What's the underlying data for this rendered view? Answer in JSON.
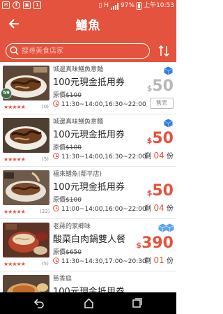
{
  "status_bar": {
    "battery": "97%",
    "time": "上午10:53",
    "network": "H"
  },
  "header": {
    "title": "鱔魚",
    "search_placeholder": "搜尋美食店家"
  },
  "items": [
    {
      "store": "城邊真味鱔魚意麵",
      "offer": "100元現金抵用券",
      "original_label": "原價",
      "original_price": "$100",
      "hours": "11:30~14:00,16:30~22:00",
      "rating_count": "(0)",
      "price_currency": "$",
      "price": "50",
      "status": "售完",
      "badge": "59"
    },
    {
      "store": "城邊真味鱔魚意麵",
      "offer": "100元現金抵用券",
      "original_label": "原價",
      "original_price": "$100",
      "hours": "11:30~14:00,16:30~22:00",
      "rating_count": "(5)",
      "price_currency": "$",
      "price": "50",
      "remain_prefix": "剩",
      "remain_count": "04",
      "remain_unit": "份"
    },
    {
      "store": "福來鱔魚(鄰平店)",
      "offer": "100元現金抵用券",
      "original_label": "原價",
      "original_price": "$100",
      "hours": "11:00~14:00,16:00~22:00",
      "rating_count": "(33)",
      "price_currency": "$",
      "price": "50",
      "remain_prefix": "剩",
      "remain_count": "04",
      "remain_unit": "份"
    },
    {
      "store": "老蔣的家鄉味",
      "offer": "酸菜白肉鍋雙人餐",
      "original_label": "原價",
      "original_price": "$650",
      "hours": "11:30~14:30,17:00~20:30",
      "rating_count": "(5)",
      "price_currency": "$",
      "price": "390",
      "remain_prefix": "剩",
      "remain_count": "01",
      "remain_unit": "份"
    },
    {
      "store": "慈香庭",
      "offer": "100元現金抵用券"
    }
  ],
  "colors": {
    "brand": "#e4533d",
    "cube": "#2f7fe0"
  }
}
